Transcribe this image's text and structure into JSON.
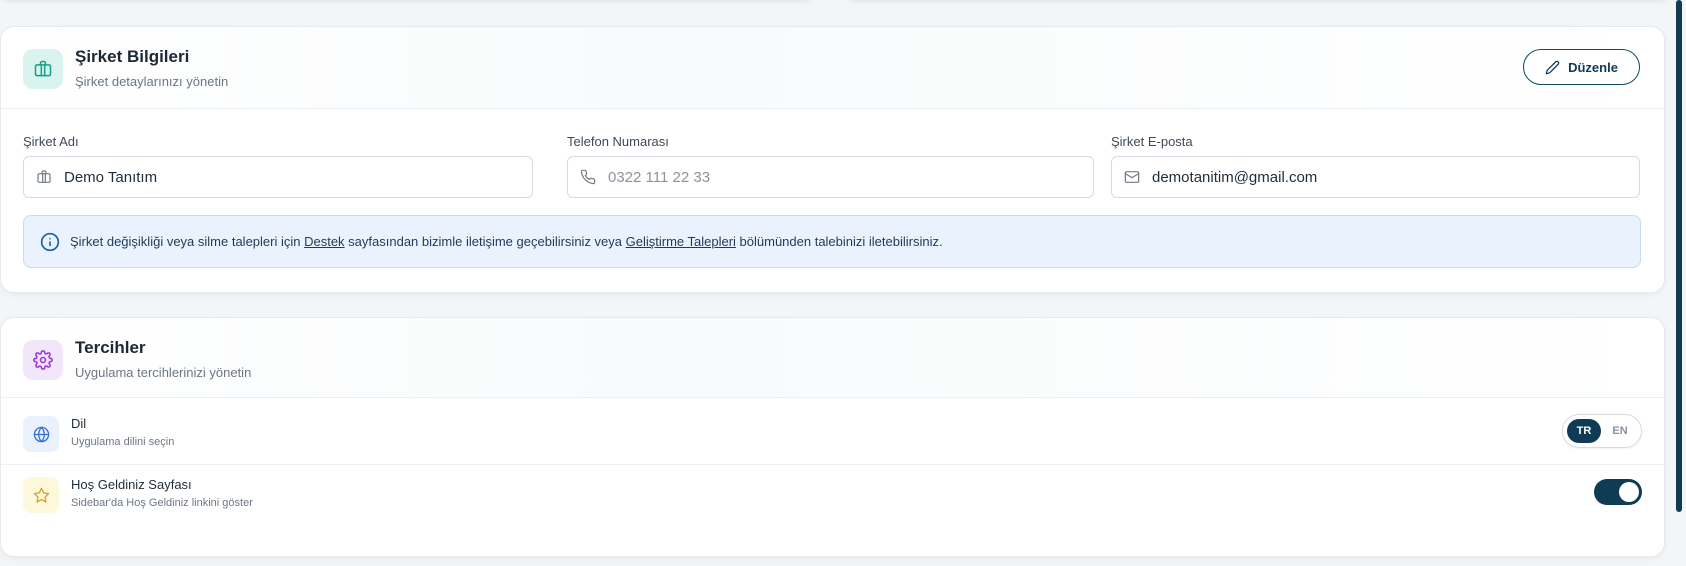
{
  "company": {
    "title": "Şirket Bilgileri",
    "subtitle": "Şirket detaylarınızı yönetin",
    "edit_label": "Düzenle",
    "fields": {
      "name_label": "Şirket Adı",
      "name_value": "Demo Tanıtım",
      "phone_label": "Telefon Numarası",
      "phone_placeholder": "0322 111 22 33",
      "email_label": "Şirket E-posta",
      "email_value": "demotanitim@gmail.com"
    },
    "info": {
      "text_1": "Şirket değişikliği veya silme talepleri için ",
      "link_support": "Destek",
      "text_2": " sayfasından bizimle iletişime geçebilirsiniz veya ",
      "link_dev_requests": "Geliştirme Talepleri",
      "text_3": " bölümünden talebinizi iletebilirsiniz."
    }
  },
  "preferences": {
    "title": "Tercihler",
    "subtitle": "Uygulama tercihlerinizi yönetin",
    "language": {
      "title": "Dil",
      "subtitle": "Uygulama dilini seçin",
      "options": [
        "TR",
        "EN"
      ],
      "selected": "TR"
    },
    "welcome_page": {
      "title": "Hoş Geldiniz Sayfası",
      "subtitle": "Sidebar'da Hoş Geldiniz linkini göster",
      "enabled": true
    }
  },
  "icons": {
    "company": "briefcase-icon",
    "edit": "pencil-icon",
    "phone": "phone-icon",
    "email": "mail-icon",
    "info": "info-icon",
    "preferences": "gear-icon",
    "language": "globe-icon",
    "welcome": "star-icon"
  },
  "colors": {
    "primary": "#0f3b55",
    "info_bg": "#eaf3fd",
    "teal_accent": "#16a085",
    "purple_accent": "#9b30d9"
  }
}
